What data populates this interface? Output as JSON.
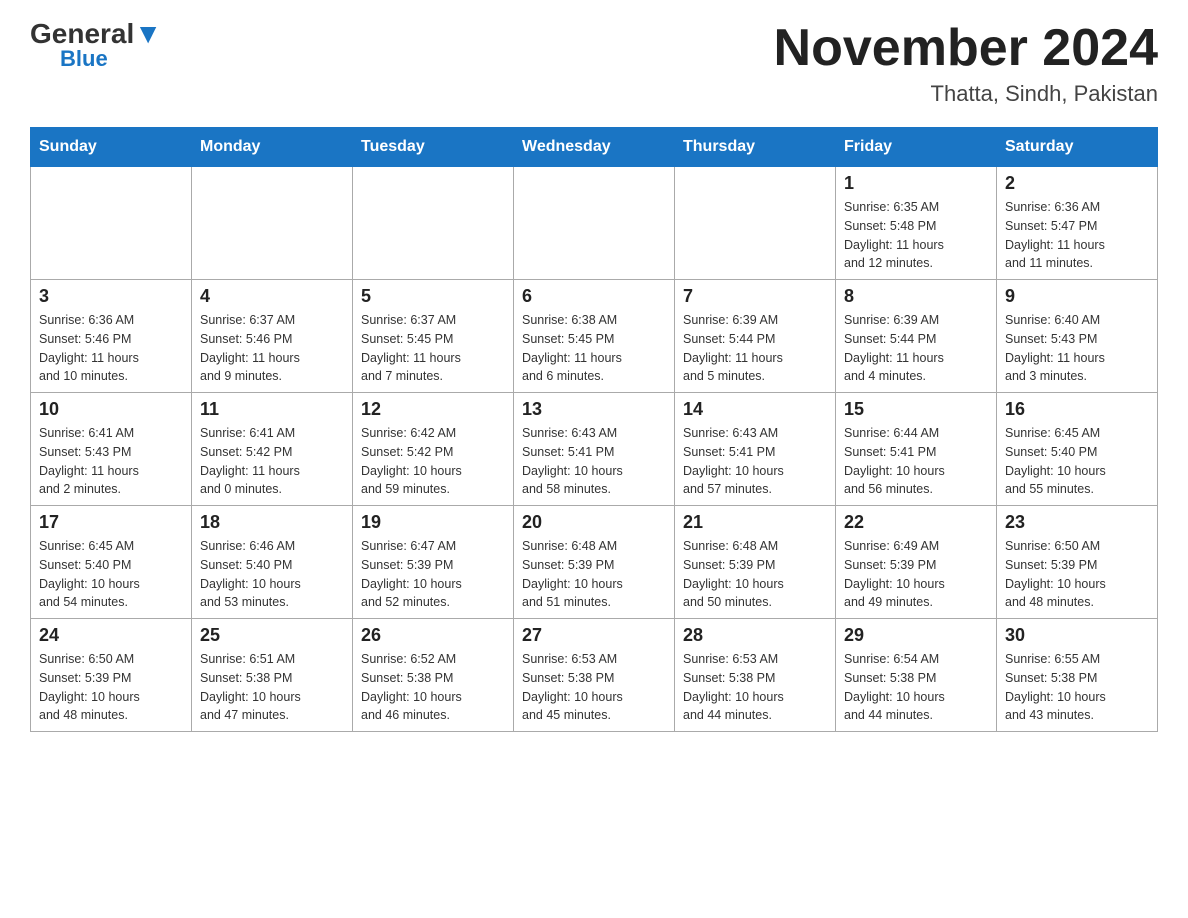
{
  "header": {
    "logo_general": "General",
    "logo_blue": "Blue",
    "month_year": "November 2024",
    "location": "Thatta, Sindh, Pakistan"
  },
  "weekdays": [
    "Sunday",
    "Monday",
    "Tuesday",
    "Wednesday",
    "Thursday",
    "Friday",
    "Saturday"
  ],
  "weeks": [
    [
      {
        "day": "",
        "info": ""
      },
      {
        "day": "",
        "info": ""
      },
      {
        "day": "",
        "info": ""
      },
      {
        "day": "",
        "info": ""
      },
      {
        "day": "",
        "info": ""
      },
      {
        "day": "1",
        "info": "Sunrise: 6:35 AM\nSunset: 5:48 PM\nDaylight: 11 hours\nand 12 minutes."
      },
      {
        "day": "2",
        "info": "Sunrise: 6:36 AM\nSunset: 5:47 PM\nDaylight: 11 hours\nand 11 minutes."
      }
    ],
    [
      {
        "day": "3",
        "info": "Sunrise: 6:36 AM\nSunset: 5:46 PM\nDaylight: 11 hours\nand 10 minutes."
      },
      {
        "day": "4",
        "info": "Sunrise: 6:37 AM\nSunset: 5:46 PM\nDaylight: 11 hours\nand 9 minutes."
      },
      {
        "day": "5",
        "info": "Sunrise: 6:37 AM\nSunset: 5:45 PM\nDaylight: 11 hours\nand 7 minutes."
      },
      {
        "day": "6",
        "info": "Sunrise: 6:38 AM\nSunset: 5:45 PM\nDaylight: 11 hours\nand 6 minutes."
      },
      {
        "day": "7",
        "info": "Sunrise: 6:39 AM\nSunset: 5:44 PM\nDaylight: 11 hours\nand 5 minutes."
      },
      {
        "day": "8",
        "info": "Sunrise: 6:39 AM\nSunset: 5:44 PM\nDaylight: 11 hours\nand 4 minutes."
      },
      {
        "day": "9",
        "info": "Sunrise: 6:40 AM\nSunset: 5:43 PM\nDaylight: 11 hours\nand 3 minutes."
      }
    ],
    [
      {
        "day": "10",
        "info": "Sunrise: 6:41 AM\nSunset: 5:43 PM\nDaylight: 11 hours\nand 2 minutes."
      },
      {
        "day": "11",
        "info": "Sunrise: 6:41 AM\nSunset: 5:42 PM\nDaylight: 11 hours\nand 0 minutes."
      },
      {
        "day": "12",
        "info": "Sunrise: 6:42 AM\nSunset: 5:42 PM\nDaylight: 10 hours\nand 59 minutes."
      },
      {
        "day": "13",
        "info": "Sunrise: 6:43 AM\nSunset: 5:41 PM\nDaylight: 10 hours\nand 58 minutes."
      },
      {
        "day": "14",
        "info": "Sunrise: 6:43 AM\nSunset: 5:41 PM\nDaylight: 10 hours\nand 57 minutes."
      },
      {
        "day": "15",
        "info": "Sunrise: 6:44 AM\nSunset: 5:41 PM\nDaylight: 10 hours\nand 56 minutes."
      },
      {
        "day": "16",
        "info": "Sunrise: 6:45 AM\nSunset: 5:40 PM\nDaylight: 10 hours\nand 55 minutes."
      }
    ],
    [
      {
        "day": "17",
        "info": "Sunrise: 6:45 AM\nSunset: 5:40 PM\nDaylight: 10 hours\nand 54 minutes."
      },
      {
        "day": "18",
        "info": "Sunrise: 6:46 AM\nSunset: 5:40 PM\nDaylight: 10 hours\nand 53 minutes."
      },
      {
        "day": "19",
        "info": "Sunrise: 6:47 AM\nSunset: 5:39 PM\nDaylight: 10 hours\nand 52 minutes."
      },
      {
        "day": "20",
        "info": "Sunrise: 6:48 AM\nSunset: 5:39 PM\nDaylight: 10 hours\nand 51 minutes."
      },
      {
        "day": "21",
        "info": "Sunrise: 6:48 AM\nSunset: 5:39 PM\nDaylight: 10 hours\nand 50 minutes."
      },
      {
        "day": "22",
        "info": "Sunrise: 6:49 AM\nSunset: 5:39 PM\nDaylight: 10 hours\nand 49 minutes."
      },
      {
        "day": "23",
        "info": "Sunrise: 6:50 AM\nSunset: 5:39 PM\nDaylight: 10 hours\nand 48 minutes."
      }
    ],
    [
      {
        "day": "24",
        "info": "Sunrise: 6:50 AM\nSunset: 5:39 PM\nDaylight: 10 hours\nand 48 minutes."
      },
      {
        "day": "25",
        "info": "Sunrise: 6:51 AM\nSunset: 5:38 PM\nDaylight: 10 hours\nand 47 minutes."
      },
      {
        "day": "26",
        "info": "Sunrise: 6:52 AM\nSunset: 5:38 PM\nDaylight: 10 hours\nand 46 minutes."
      },
      {
        "day": "27",
        "info": "Sunrise: 6:53 AM\nSunset: 5:38 PM\nDaylight: 10 hours\nand 45 minutes."
      },
      {
        "day": "28",
        "info": "Sunrise: 6:53 AM\nSunset: 5:38 PM\nDaylight: 10 hours\nand 44 minutes."
      },
      {
        "day": "29",
        "info": "Sunrise: 6:54 AM\nSunset: 5:38 PM\nDaylight: 10 hours\nand 44 minutes."
      },
      {
        "day": "30",
        "info": "Sunrise: 6:55 AM\nSunset: 5:38 PM\nDaylight: 10 hours\nand 43 minutes."
      }
    ]
  ]
}
